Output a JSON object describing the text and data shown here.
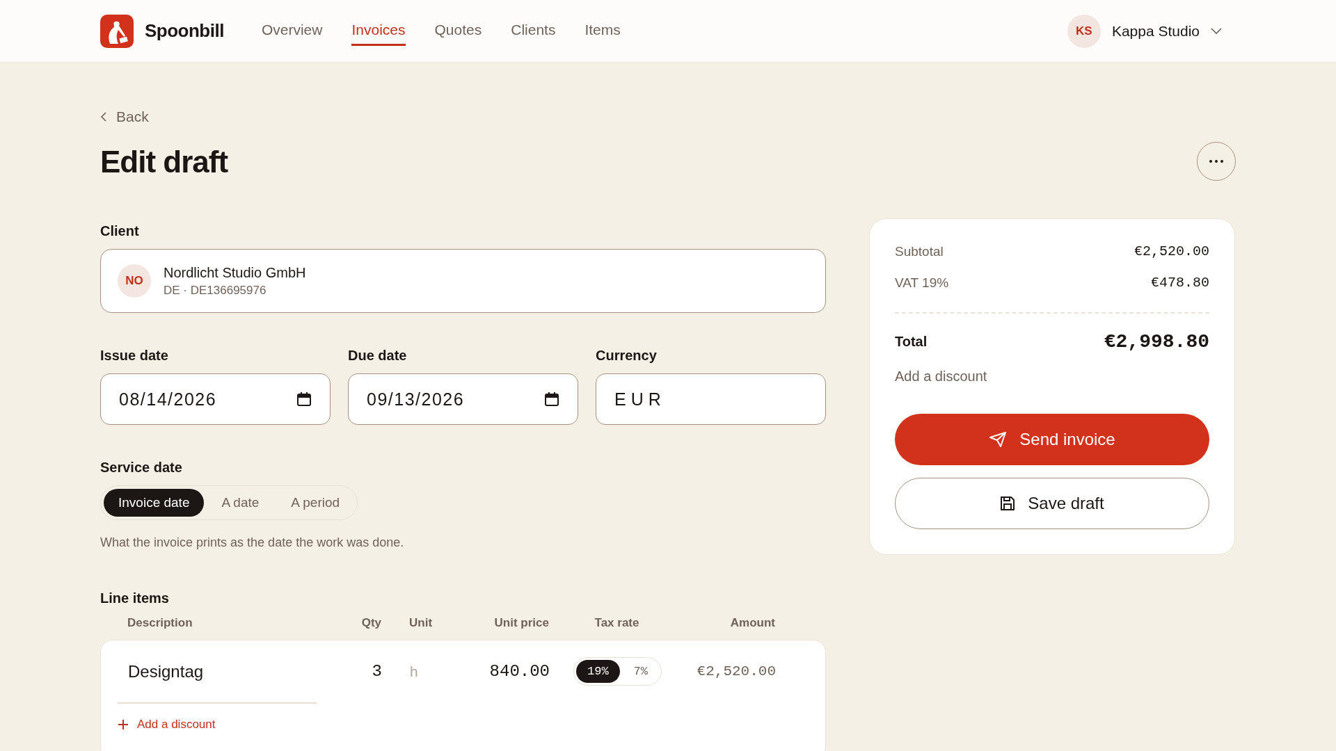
{
  "brand": {
    "name": "Spoonbill"
  },
  "nav": [
    {
      "label": "Overview",
      "selected": false
    },
    {
      "label": "Invoices",
      "selected": true
    },
    {
      "label": "Quotes",
      "selected": false
    },
    {
      "label": "Clients",
      "selected": false
    },
    {
      "label": "Items",
      "selected": false
    }
  ],
  "account": {
    "initials": "KS",
    "name": "Kappa Studio"
  },
  "back": "Back",
  "title": "Edit draft",
  "client": {
    "label": "Client",
    "initials": "NO",
    "name": "Nordlicht Studio GmbH",
    "vat_id": "DE · DE136695976"
  },
  "fields": [
    {
      "kind": "date",
      "label": "Issue date",
      "value": "08/14/2026"
    },
    {
      "kind": "date",
      "label": "Due date",
      "value": "09/13/2026"
    },
    {
      "kind": "text",
      "label": "Currency",
      "value": "EUR"
    }
  ],
  "service_date": {
    "label": "Service date",
    "options": [
      {
        "label": "Invoice date",
        "selected": true
      },
      {
        "label": "A date",
        "selected": false
      },
      {
        "label": "A period",
        "selected": false
      }
    ],
    "help": "What the invoice prints as the date the work was done."
  },
  "line_items": {
    "title": "Line items",
    "columns": [
      "Description",
      "Qty",
      "Unit",
      "Unit price",
      "Tax rate",
      "Amount"
    ],
    "rows": [
      {
        "description": "Designtag",
        "qty": "3",
        "unit": "h",
        "unit_price": "840.00",
        "tax_options": [
          {
            "label": "19%",
            "selected": true
          },
          {
            "label": "7%",
            "selected": false
          }
        ],
        "amount": "€2,520.00"
      }
    ],
    "add_discount": "Add a discount"
  },
  "summary": {
    "rows": [
      {
        "label": "Subtotal",
        "value": "€2,520.00"
      },
      {
        "label": "VAT 19%",
        "value": "€478.80"
      }
    ],
    "total_label": "Total",
    "total_value": "€2,998.80",
    "add_discount": "Add a discount",
    "send": "Send invoice",
    "save": "Save draft"
  }
}
